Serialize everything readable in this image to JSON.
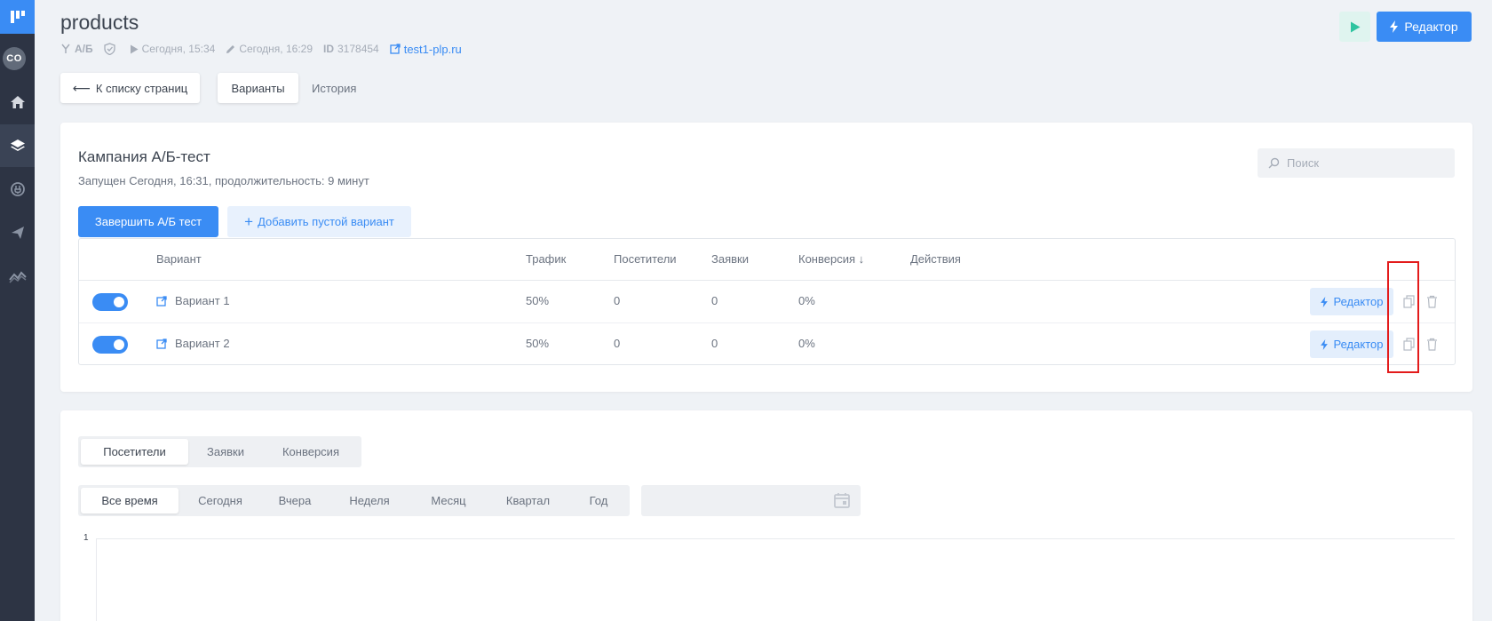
{
  "sidebar": {
    "avatar_initials": "CO",
    "items": [
      {
        "icon": "home-icon"
      },
      {
        "icon": "layers-icon",
        "active": true
      },
      {
        "icon": "integrations-icon"
      },
      {
        "icon": "send-icon"
      },
      {
        "icon": "analytics-icon"
      }
    ]
  },
  "header": {
    "title": "products",
    "meta": {
      "ab_label": "А/Б",
      "published": "Сегодня, 15:34",
      "edited": "Сегодня, 16:29",
      "id_label": "ID",
      "id_value": "3178454",
      "domain": "test1-plp.ru"
    },
    "editor_label": "Редактор"
  },
  "nav": {
    "back_label": "К списку страниц",
    "tabs": [
      "Варианты",
      "История"
    ]
  },
  "campaign": {
    "title": "Кампания А/Б-тест",
    "subtitle": "Запущен Сегодня, 16:31, продолжительность: 9 минут",
    "search_placeholder": "Поиск",
    "finish_label": "Завершить А/Б тест",
    "add_label": "Добавить пустой вариант",
    "columns": {
      "variant": "Вариант",
      "traffic": "Трафик",
      "visitors": "Посетители",
      "leads": "Заявки",
      "conversion": "Конверсия ↓",
      "actions": "Действия"
    },
    "rows": [
      {
        "name": "Вариант 1",
        "traffic": "50%",
        "visitors": "0",
        "leads": "0",
        "conversion": "0%",
        "editor": "Редактор",
        "enabled": true
      },
      {
        "name": "Вариант 2",
        "traffic": "50%",
        "visitors": "0",
        "leads": "0",
        "conversion": "0%",
        "editor": "Редактор",
        "enabled": true
      }
    ]
  },
  "stats": {
    "metric_tabs": [
      "Посетители",
      "Заявки",
      "Конверсия"
    ],
    "period_tabs": [
      "Все время",
      "Сегодня",
      "Вчера",
      "Неделя",
      "Месяц",
      "Квартал",
      "Год"
    ],
    "y_tick": "1"
  },
  "colors": {
    "accent": "#3a8cf4",
    "sidebar": "#2d3444",
    "play_bg": "#dff4ef",
    "play_icon": "#2ec4a0",
    "highlight": "#e31b1b"
  }
}
